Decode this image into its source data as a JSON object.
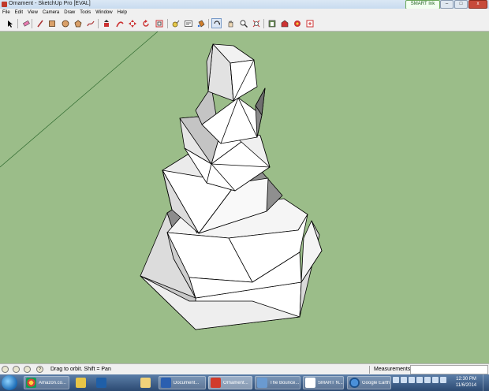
{
  "window": {
    "title": "Ornament - SketchUp Pro [EVAL]",
    "smart_ink": "SMART Ink",
    "min_symbol": "–",
    "max_symbol": "□",
    "close_symbol": "x"
  },
  "menu": [
    "File",
    "Edit",
    "View",
    "Camera",
    "Draw",
    "Tools",
    "Window",
    "Help"
  ],
  "toolbar": {
    "tools": [
      "select-tool",
      "eraser-tool",
      "rectangle-tool",
      "line-tool",
      "circle-tool",
      "arc-tool",
      "polygon-tool",
      "freehand-tool",
      "push-pull-tool",
      "follow-me-tool",
      "move-tool",
      "rotate-tool",
      "scale-tool",
      "offset-tool",
      "tape-measure-tool",
      "dimension-tool",
      "protractor-tool",
      "text-tool",
      "axes-tool",
      "3d-text-tool",
      "paint-bucket-tool",
      "orbit-tool",
      "pan-tool",
      "zoom-tool",
      "zoom-extents-tool",
      "previous-view-tool",
      "warehouse-tool",
      "share-model-tool",
      "extension-warehouse-tool"
    ],
    "active_tool": "orbit-tool"
  },
  "viewport": {
    "background_color": "#9bbd89",
    "model_name": "Ornament"
  },
  "status": {
    "hint": "Drag to orbit.  Shift = Pan",
    "measurements_label": "Measurements",
    "measurements_value": ""
  },
  "taskbar": {
    "items": [
      {
        "name": "chrome",
        "label": "Amazon.co..."
      },
      {
        "name": "pen-app",
        "label": ""
      },
      {
        "name": "outlook",
        "label": ""
      },
      {
        "name": "explorer",
        "label": ""
      },
      {
        "name": "word",
        "label": "Document..."
      },
      {
        "name": "sketchup",
        "label": "Ornament..."
      },
      {
        "name": "bouncer",
        "label": "The Bounce..."
      },
      {
        "name": "smart-notebook",
        "label": "SMART N..."
      },
      {
        "name": "google-earth",
        "label": "Google Earth"
      }
    ],
    "clock_time": "12:30 PM",
    "clock_date": "11/6/2014"
  },
  "colors": {
    "accent": "#1b6bb5",
    "model_face": "#ffffff",
    "model_shade": "#c9c9c9",
    "model_dark": "#888888",
    "edge": "#000000"
  }
}
